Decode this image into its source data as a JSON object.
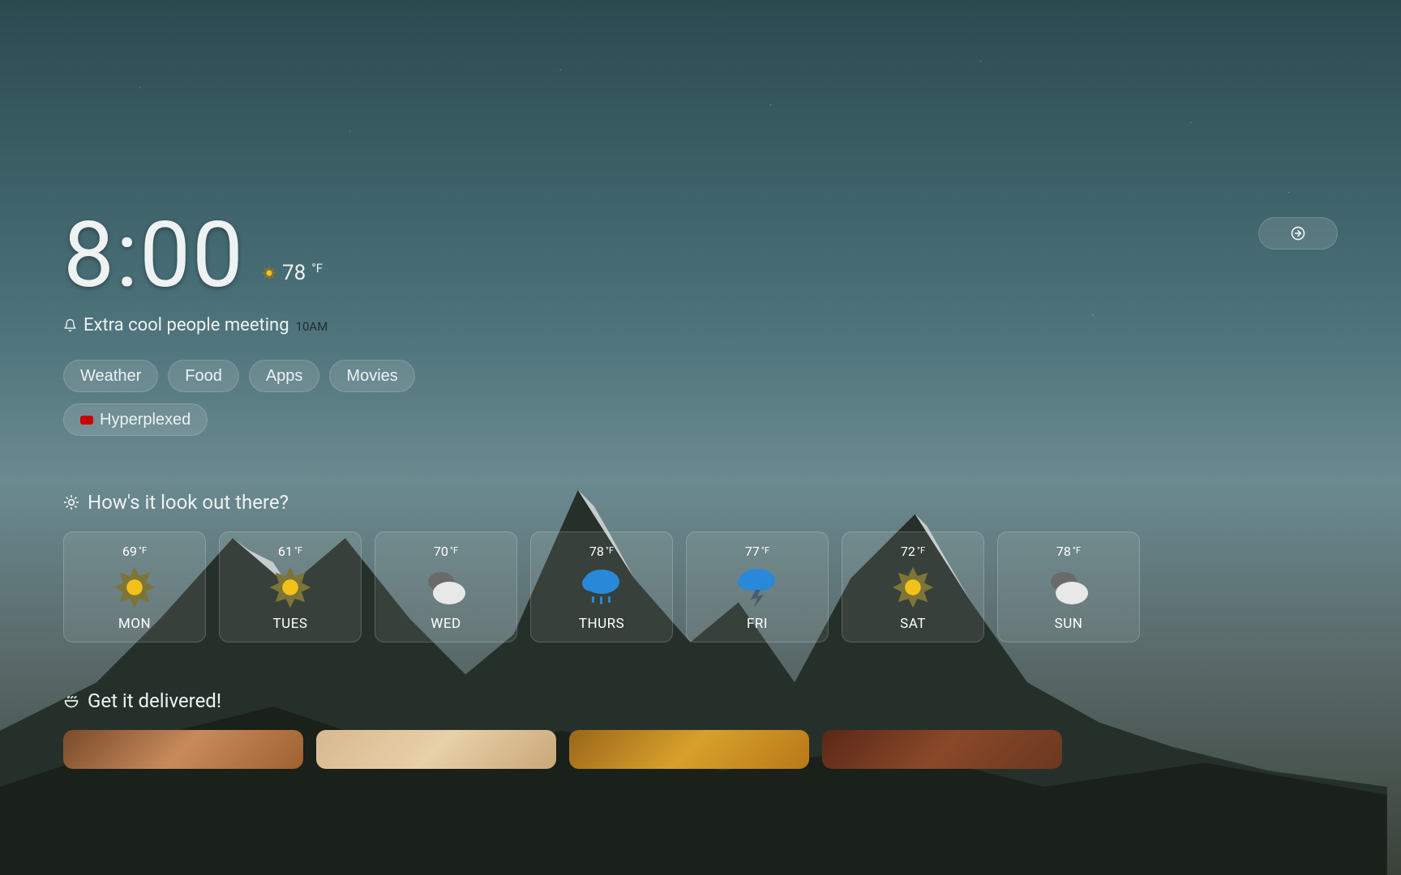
{
  "clock": {
    "time": "8:00"
  },
  "current_weather": {
    "temp": "78",
    "unit": "°F",
    "icon": "sun"
  },
  "reminder": {
    "text": "Extra cool people meeting",
    "time": "10AM"
  },
  "tabs": [
    "Weather",
    "Food",
    "Apps",
    "Movies"
  ],
  "tags": [
    {
      "label": "Hyperplexed",
      "color": "#cc0000"
    }
  ],
  "weather_section": {
    "title": "How's it look out there?",
    "days": [
      {
        "temp": "69",
        "unit": "°F",
        "day": "MON",
        "icon": "sun"
      },
      {
        "temp": "61",
        "unit": "°F",
        "day": "TUES",
        "icon": "sun"
      },
      {
        "temp": "70",
        "unit": "°F",
        "day": "WED",
        "icon": "cloudy"
      },
      {
        "temp": "78",
        "unit": "°F",
        "day": "THURS",
        "icon": "rain"
      },
      {
        "temp": "77",
        "unit": "°F",
        "day": "FRI",
        "icon": "storm"
      },
      {
        "temp": "72",
        "unit": "°F",
        "day": "SAT",
        "icon": "sun"
      },
      {
        "temp": "78",
        "unit": "°F",
        "day": "SUN",
        "icon": "cloudy"
      }
    ]
  },
  "food_section": {
    "title": "Get it delivered!"
  }
}
